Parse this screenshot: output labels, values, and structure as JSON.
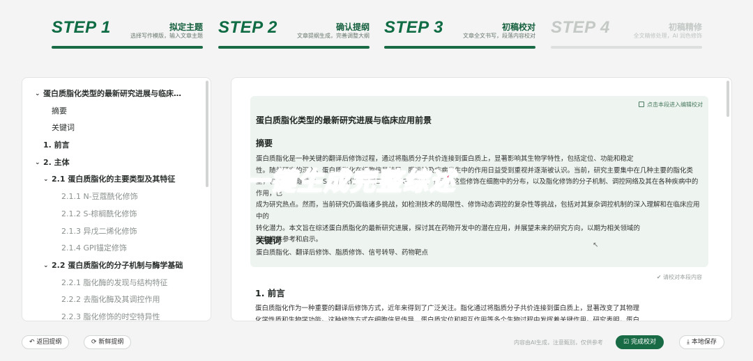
{
  "steps": [
    {
      "num": "STEP 1",
      "title": "拟定主题",
      "sub": "选择写作模版，输入文章主题"
    },
    {
      "num": "STEP 2",
      "title": "确认提纲",
      "sub": "文章提纲生成，完善调整大纲"
    },
    {
      "num": "STEP 3",
      "title": "初稿校对",
      "sub": "文章全文书写，段落内容校对"
    },
    {
      "num": "STEP 4",
      "title": "初稿精修",
      "sub": "全文精修处理，AI 润色修饰"
    }
  ],
  "outline": [
    "蛋白质脂化类型的最新研究进展与临床…",
    "摘要",
    "关键词",
    "1. 前言",
    "2. 主体",
    "2.1 蛋白质脂化的主要类型及其特征",
    "2.1.1 N-豆蔻酰化修饰",
    "2.1.2 S-棕榈酰化修饰",
    "2.1.3 异戊二烯化修饰",
    "2.1.4 GPI锚定修饰",
    "2.2 蛋白质脂化的分子机制与酶学基础",
    "2.2.1 脂化酶的发现与结构特征",
    "2.2.2 去脂化酶及其调控作用",
    "2.2.3 脂化修饰的时空特异性"
  ],
  "document": {
    "hint": "点击本段进入编辑校对",
    "title": "蛋白质脂化类型的最新研究进展与临床应用前景",
    "abstract_heading": "摘要",
    "abstract_lines": [
      "蛋白质脂化是一种关键的翻译后修饰过程，通过将脂质分子共价连接到蛋白质上，显著影响其生物学特性，包括定位、功能和稳定",
      "性。随着研究的深入，蛋白质脂化在细胞信号转导、膜运输及疾病发生中的作用日益受到重视并逐渐被认识。当前，研究主要集中在几种主要的脂化类",
      "型，包括N-豆蔻酰化、S-棕榈酰化、异戊二烯化和GPI锚定，揭示了这些修饰在细胞中的分布，以及脂化修饰的分子机制、调控网络及其在各种疾病中的作用，已",
      "成为研究热点。然而，当前研究仍面临诸多挑战，如检测技术的局限性、修饰动态调控的复杂性等挑战，包括对其复杂调控机制的深入理解和在临床应用中的",
      "转化潜力。本文旨在综述蛋白质脂化的最新研究进展，探讨其在药物开发中的潜在应用，并展望未来的研究方向，以期为相关领域的",
      "研究提供参考和启示。"
    ],
    "keywords_heading": "关键词",
    "keywords": "蛋白质脂化、翻译后修饰、脂质修饰、信号转导、药物靶点",
    "check": "请校对本段内容",
    "intro_heading": "1. 前言",
    "intro_lines": [
      "蛋白质脂化作为一种重要的翻译后修饰方式，近年来得到了广泛关注。脂化通过将脂质分子共价连接到蛋白质上，显著改变了其物理",
      "化学性质和生物学功能。这种修饰方式在细胞信号传导、蛋白质定位和相互作用等多个生物过程中发挥着关键作用。研究表明，蛋白"
    ]
  },
  "overlay": "一键生成完整综述",
  "footer": {
    "back": "返回提纲",
    "regen": "新鲜提纲",
    "note": "内容由AI生成，注意甄别，仅供参考",
    "finish": "完成校对",
    "save": "本地保存"
  }
}
